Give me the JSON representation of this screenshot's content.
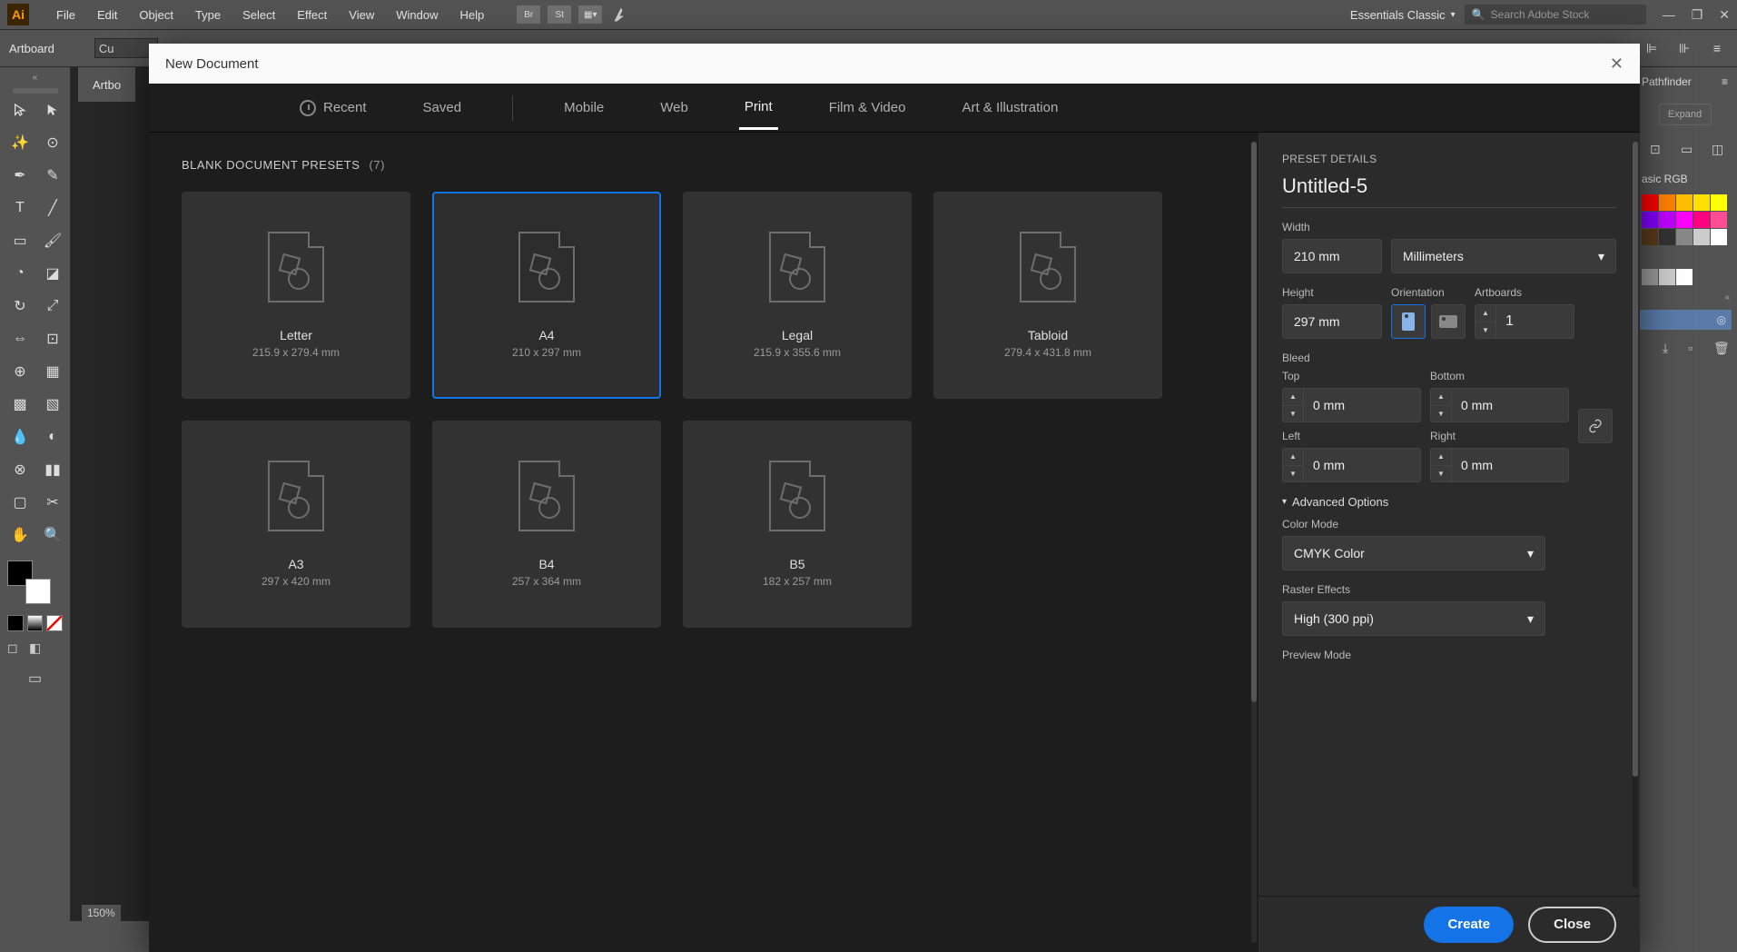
{
  "app": {
    "logo": "Ai"
  },
  "menubar": {
    "items": [
      "File",
      "Edit",
      "Object",
      "Type",
      "Select",
      "Effect",
      "View",
      "Window",
      "Help"
    ],
    "ext": {
      "br": "Br",
      "st": "St"
    },
    "workspace": "Essentials Classic",
    "stock_placeholder": "Search Adobe Stock"
  },
  "controlbar": {
    "label": "Artboard",
    "ext_field": "Cu"
  },
  "doc_tab": "Artbo",
  "zoom": "150%",
  "right": {
    "pathfinder": "Pathfinder",
    "expand": "Expand",
    "basic_rgb": "asic RGB"
  },
  "modal": {
    "title": "New Document",
    "tabs": [
      "Recent",
      "Saved",
      "Mobile",
      "Web",
      "Print",
      "Film & Video",
      "Art & Illustration"
    ],
    "active_tab": "Print",
    "presets_heading": "BLANK DOCUMENT PRESETS",
    "presets_count": "(7)",
    "presets": [
      {
        "name": "Letter",
        "dims": "215.9 x 279.4 mm"
      },
      {
        "name": "A4",
        "dims": "210 x 297 mm"
      },
      {
        "name": "Legal",
        "dims": "215.9 x 355.6 mm"
      },
      {
        "name": "Tabloid",
        "dims": "279.4 x 431.8 mm"
      },
      {
        "name": "A3",
        "dims": "297 x 420 mm"
      },
      {
        "name": "B4",
        "dims": "257 x 364 mm"
      },
      {
        "name": "B5",
        "dims": "182 x 257 mm"
      }
    ],
    "selected_preset": "A4",
    "details": {
      "heading": "PRESET DETAILS",
      "doc_name": "Untitled-5",
      "labels": {
        "width": "Width",
        "height": "Height",
        "orientation": "Orientation",
        "artboards": "Artboards",
        "bleed": "Bleed",
        "top": "Top",
        "bottom": "Bottom",
        "left": "Left",
        "right": "Right",
        "advanced": "Advanced Options",
        "color_mode": "Color Mode",
        "raster": "Raster Effects",
        "preview": "Preview Mode"
      },
      "width": "210 mm",
      "height": "297 mm",
      "units": "Millimeters",
      "artboards": "1",
      "bleed": {
        "top": "0 mm",
        "bottom": "0 mm",
        "left": "0 mm",
        "right": "0 mm"
      },
      "color_mode": "CMYK Color",
      "raster": "High (300 ppi)"
    },
    "buttons": {
      "create": "Create",
      "close": "Close"
    }
  }
}
